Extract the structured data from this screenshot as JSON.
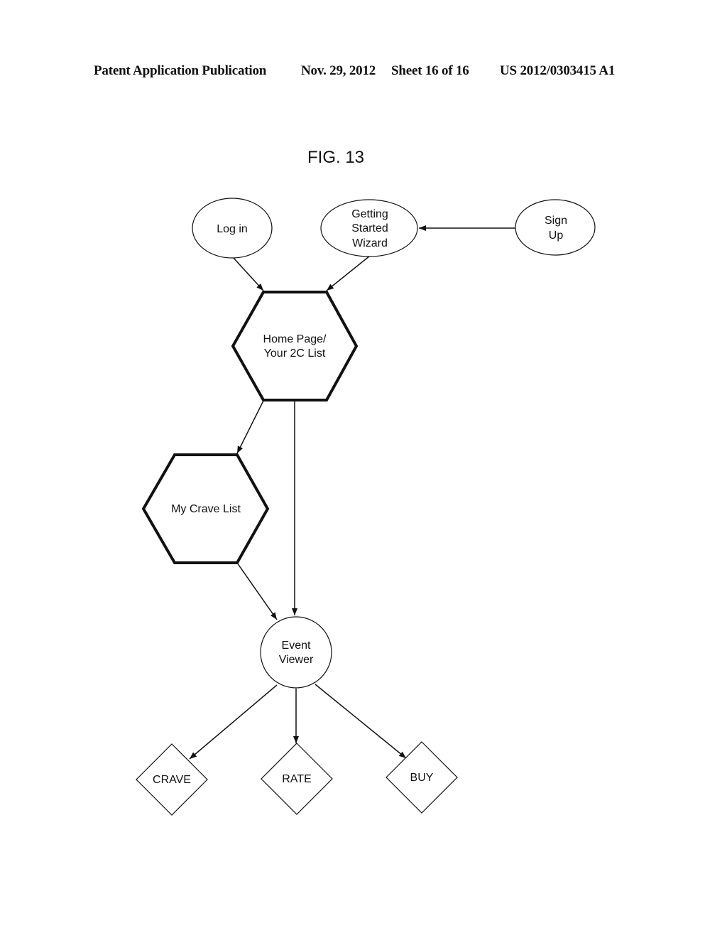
{
  "header": {
    "publication": "Patent Application Publication",
    "date": "Nov. 29, 2012",
    "sheet": "Sheet 16 of 16",
    "number": "US 2012/0303415 A1"
  },
  "figure": {
    "title": "FIG. 13"
  },
  "nodes": {
    "login": {
      "shape": "ellipse",
      "lines": [
        "Log in"
      ]
    },
    "wizard": {
      "shape": "ellipse",
      "lines": [
        "Getting",
        "Started",
        "Wizard"
      ]
    },
    "signup": {
      "shape": "ellipse",
      "lines": [
        "Sign",
        "Up"
      ]
    },
    "home": {
      "shape": "hexagon",
      "lines": [
        "Home Page/",
        "Your 2C List"
      ]
    },
    "crave_list": {
      "shape": "hexagon",
      "lines": [
        "My Crave List"
      ]
    },
    "event_viewer": {
      "shape": "circle",
      "lines": [
        "Event",
        "Viewer"
      ]
    },
    "crave": {
      "shape": "diamond",
      "lines": [
        "CRAVE"
      ]
    },
    "rate": {
      "shape": "diamond",
      "lines": [
        "RATE"
      ]
    },
    "buy": {
      "shape": "diamond",
      "lines": [
        "BUY"
      ]
    }
  },
  "edges": [
    {
      "from": "signup",
      "to": "wizard"
    },
    {
      "from": "login",
      "to": "home"
    },
    {
      "from": "wizard",
      "to": "home"
    },
    {
      "from": "home",
      "to": "crave_list"
    },
    {
      "from": "home",
      "to": "event_viewer"
    },
    {
      "from": "crave_list",
      "to": "event_viewer"
    },
    {
      "from": "event_viewer",
      "to": "crave"
    },
    {
      "from": "event_viewer",
      "to": "rate"
    },
    {
      "from": "event_viewer",
      "to": "buy"
    }
  ]
}
